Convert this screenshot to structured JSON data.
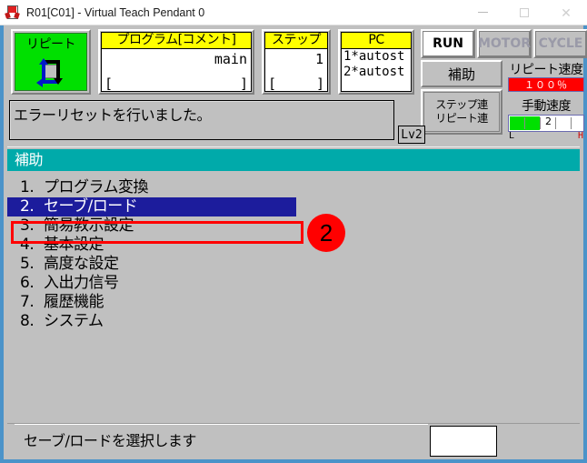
{
  "window": {
    "title": "R01[C01] - Virtual Teach Pendant 0",
    "icon": "app-icon",
    "controls": {
      "minimize": "—",
      "maximize": "□",
      "close": "✕"
    }
  },
  "status_panels": {
    "mode_tile": {
      "label": "リピート",
      "icon": "cycle-arrows-icon",
      "active_color": "#00e000"
    },
    "program": {
      "header": "プログラム[コメント]",
      "value": "main",
      "bracket_left": "[",
      "bracket_right": "]"
    },
    "step": {
      "header": "ステップ",
      "value": "1",
      "bracket_left": "[",
      "bracket_right": "]"
    },
    "pc": {
      "header": "PC",
      "line1": "1*autost",
      "line2": "2*autost"
    },
    "state_buttons": [
      {
        "label": "RUN",
        "active": true
      },
      {
        "label": "MOTOR",
        "active": false
      },
      {
        "label": "CYCLE",
        "active": false
      }
    ],
    "aux_button": {
      "label": "補助"
    },
    "continuous_button": {
      "line1": "ステップ連",
      "line2": "リピート連"
    },
    "repeat_speed": {
      "label": "リピート速度",
      "value": "１００％",
      "color": "#ff0000"
    },
    "manual_speed": {
      "label": "手動速度",
      "value": "2",
      "low_label": "L",
      "high_label": "H",
      "fill_percent": 40,
      "color": "#00e000"
    }
  },
  "message_bar": {
    "text": "エラーリセットを行いました。",
    "level_badge": "Lv2"
  },
  "main": {
    "section_title": "補助",
    "menu_items": [
      {
        "num": "1.",
        "label": "プログラム変換",
        "selected": false
      },
      {
        "num": "2.",
        "label": "セーブ/ロード",
        "selected": true
      },
      {
        "num": "3.",
        "label": "簡易教示設定",
        "selected": false
      },
      {
        "num": "4.",
        "label": "基本設定",
        "selected": false
      },
      {
        "num": "5.",
        "label": "高度な設定",
        "selected": false
      },
      {
        "num": "6.",
        "label": "入出力信号",
        "selected": false
      },
      {
        "num": "7.",
        "label": "履歴機能",
        "selected": false
      },
      {
        "num": "8.",
        "label": "システム",
        "selected": false
      }
    ],
    "annotation": {
      "badge_number": "2",
      "highlight_color": "#ff0000"
    }
  },
  "bottom": {
    "hint_text": "セーブ/ロードを選択します",
    "input_value": ""
  }
}
